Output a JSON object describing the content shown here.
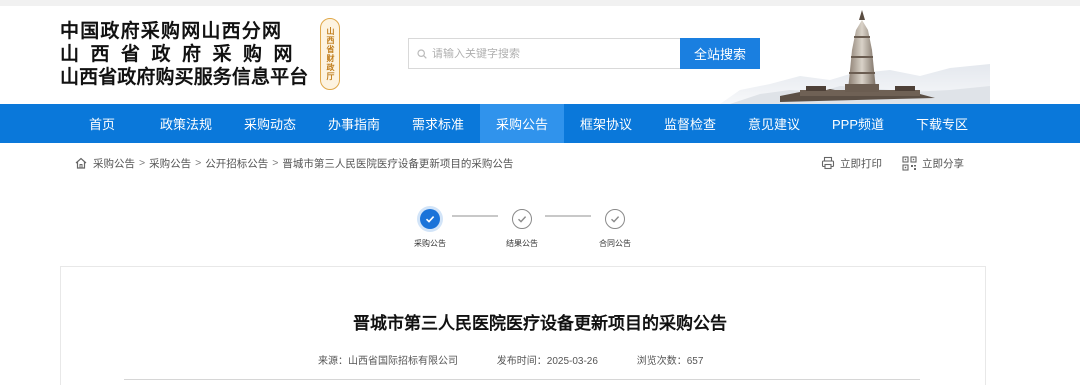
{
  "header": {
    "logo_line1": "中国政府采购网山西分网",
    "logo_line2": "山西省政府采购网",
    "logo_line3": "山西省政府购买服务信息平台",
    "seal_text": "山西省财政厅"
  },
  "search": {
    "placeholder": "请输入关键字搜索",
    "value": "",
    "button_label": "全站搜索"
  },
  "nav": {
    "items": [
      {
        "label": "首页"
      },
      {
        "label": "政策法规"
      },
      {
        "label": "采购动态"
      },
      {
        "label": "办事指南"
      },
      {
        "label": "需求标准"
      },
      {
        "label": "采购公告",
        "active": true
      },
      {
        "label": "框架协议"
      },
      {
        "label": "监督检查"
      },
      {
        "label": "意见建议"
      },
      {
        "label": "PPP频道"
      },
      {
        "label": "下载专区"
      }
    ],
    "active_color": "#3093ec",
    "bar_color": "#0a78da"
  },
  "breadcrumb": {
    "items": [
      "采购公告",
      "采购公告",
      "公开招标公告",
      "晋城市第三人民医院医疗设备更新项目的采购公告"
    ],
    "separator": ">"
  },
  "actions": {
    "print_label": "立即打印",
    "share_label": "立即分享"
  },
  "steps": {
    "items": [
      {
        "label": "采购公告",
        "state": "active"
      },
      {
        "label": "结果公告",
        "state": "pending"
      },
      {
        "label": "合同公告",
        "state": "pending"
      }
    ],
    "active_color": "#1a73d9"
  },
  "article": {
    "title": "晋城市第三人民医院医疗设备更新项目的采购公告",
    "source": "来源：山西省国际招标有限公司",
    "publish_time": "发布时间：2025-03-26",
    "views": "浏览次数：657"
  },
  "icons": {
    "search": "search-icon",
    "home": "home-icon",
    "print": "printer-icon",
    "share": "qr-code-icon",
    "step_check": "check-circle-icon"
  }
}
